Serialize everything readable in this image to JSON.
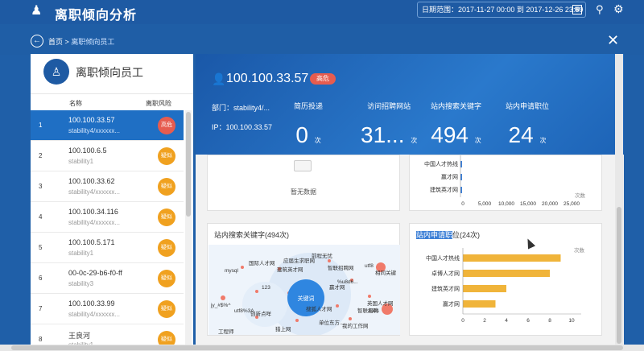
{
  "app": {
    "title": "离职倾向分析"
  },
  "header": {
    "date_range": "日期范围：2017-11-27 00:00 到 2017-12-26 23:59"
  },
  "breadcrumb": {
    "home": "首页",
    "separator": ">",
    "current": "离职倾向员工"
  },
  "left_panel": {
    "title": "离职倾向员工",
    "col_name": "名称",
    "col_risk": "离职风险",
    "rows": [
      {
        "idx": "1",
        "ip": "100.100.33.57",
        "dept": "stability4/xxxxxx...",
        "risk": "高危",
        "level": "high"
      },
      {
        "idx": "2",
        "ip": "100.100.6.5",
        "dept": "stability1",
        "risk": "疑似",
        "level": "mid"
      },
      {
        "idx": "3",
        "ip": "100.100.33.62",
        "dept": "stability4/xxxxxx...",
        "risk": "疑似",
        "level": "mid"
      },
      {
        "idx": "4",
        "ip": "100.100.34.116",
        "dept": "stability4/xxxxxx...",
        "risk": "疑似",
        "level": "mid"
      },
      {
        "idx": "5",
        "ip": "100.100.5.171",
        "dept": "stability1",
        "risk": "疑似",
        "level": "mid"
      },
      {
        "idx": "6",
        "ip": "00-0c-29-b6-f0-ff",
        "dept": "stability3",
        "risk": "疑似",
        "level": "mid"
      },
      {
        "idx": "7",
        "ip": "100.100.33.99",
        "dept": "stability4/xxxxxx...",
        "risk": "疑似",
        "level": "mid"
      },
      {
        "idx": "8",
        "ip": "王良河",
        "dept": "stability1",
        "risk": "疑似",
        "level": "mid"
      }
    ]
  },
  "detail": {
    "ip": "100.100.33.57",
    "badge": "高危",
    "dept": "部门：stability4/...",
    "ip_line": "IP：100.100.33.57",
    "stats": [
      {
        "label": "简历投递",
        "value": "0",
        "unit": "次"
      },
      {
        "label": "访问招聘网站",
        "value": "31...",
        "unit": "次"
      },
      {
        "label": "站内搜索关键字",
        "value": "494",
        "unit": "次"
      },
      {
        "label": "站内申请职位",
        "value": "24",
        "unit": "次"
      }
    ],
    "empty_text": "暂无数据"
  },
  "site_chart": {
    "labels": [
      "中国人才热线",
      "赢才网",
      "建筑英才网"
    ],
    "ticks": [
      "0",
      "5,000",
      "10,000",
      "15,000",
      "20,000",
      "25,000"
    ],
    "unit": "次数"
  },
  "keyword_cloud": {
    "title": "站内搜索关键字(494次)",
    "center": "关键词",
    "words": [
      "国际人才网",
      "应届生求职网",
      "前程无忧",
      "mysql",
      "建筑英才网",
      "智联招聘网",
      "utf8",
      "相同关键",
      "123",
      "%u8d6...",
      "jy_#$%^",
      "搜狐人才网",
      "英国人才网",
      "赢才网",
      "utf8%3A",
      "创新点咩",
      "智联招聘",
      "Jobs",
      "猎上网",
      "单位东方..",
      "我的工作网",
      "工程师"
    ]
  },
  "apply_chart": {
    "title_hl": "站内申请职",
    "title_rest": "位(24次)",
    "unit": "次数",
    "ticks": [
      "0",
      "2",
      "4",
      "6",
      "8",
      "10"
    ],
    "xmax": 10,
    "categories": [
      "中国人才热线",
      "卓博人才网",
      "建筑英才网",
      "赢才网"
    ],
    "values": [
      9,
      8,
      4,
      3
    ],
    "color": "#f0b43a"
  }
}
